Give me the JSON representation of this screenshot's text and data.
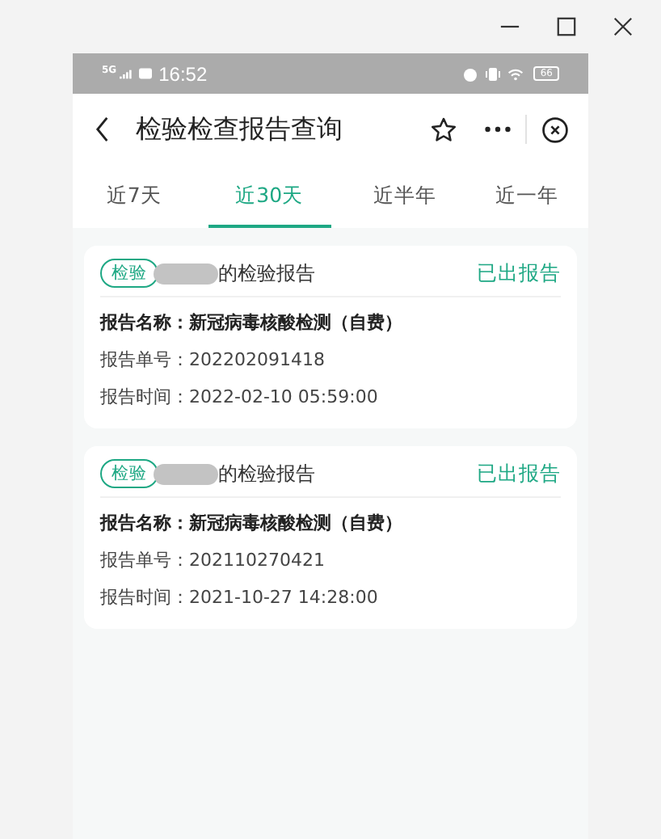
{
  "status_bar": {
    "network": "5G",
    "time": "16:52",
    "battery": "66"
  },
  "header": {
    "title": "检验检查报告查询"
  },
  "tabs": [
    {
      "label": "近7天",
      "selected": false
    },
    {
      "label": "近30天",
      "selected": true
    },
    {
      "label": "近半年",
      "selected": false
    },
    {
      "label": "近一年",
      "selected": false
    }
  ],
  "reports": [
    {
      "tag": "检验",
      "owner_suffix": "的检验报告",
      "status": "已出报告",
      "fields": [
        {
          "label": "报告名称：",
          "value": "新冠病毒核酸检测（自费）",
          "bold": true
        },
        {
          "label": "报告单号：",
          "value": "202202091418",
          "bold": false
        },
        {
          "label": "报告时间：",
          "value": "2022-02-10 05:59:00",
          "bold": false
        }
      ]
    },
    {
      "tag": "检验",
      "owner_suffix": "的检验报告",
      "status": "已出报告",
      "fields": [
        {
          "label": "报告名称：",
          "value": "新冠病毒核酸检测（自费）",
          "bold": true
        },
        {
          "label": "报告单号：",
          "value": "202110270421",
          "bold": false
        },
        {
          "label": "报告时间：",
          "value": "2021-10-27 14:28:00",
          "bold": false
        }
      ]
    }
  ]
}
